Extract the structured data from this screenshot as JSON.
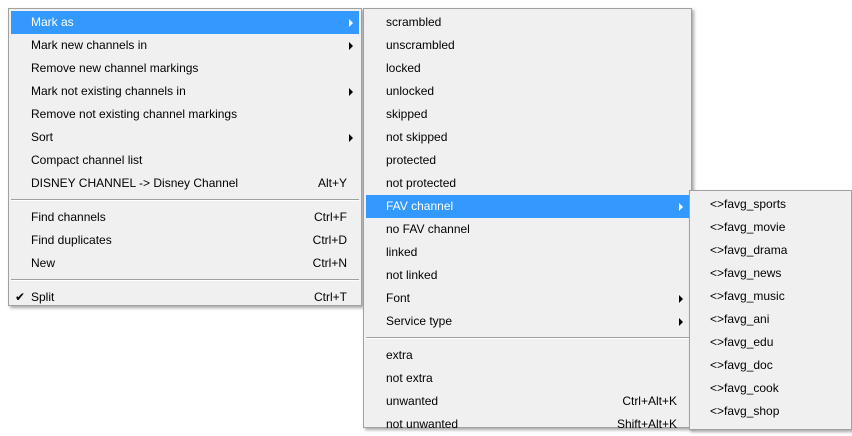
{
  "main_menu": {
    "items": [
      {
        "label": "Mark as",
        "shortcut": "",
        "submenu": true,
        "highlighted": true
      },
      {
        "label": "Mark new channels in",
        "shortcut": "",
        "submenu": true
      },
      {
        "label": "Remove new channel markings",
        "shortcut": ""
      },
      {
        "label": "Mark not existing channels in",
        "shortcut": "",
        "submenu": true
      },
      {
        "label": "Remove not existing channel markings",
        "shortcut": ""
      },
      {
        "label": "Sort",
        "shortcut": "",
        "submenu": true
      },
      {
        "label": "Compact channel list",
        "shortcut": ""
      },
      {
        "label": "DISNEY CHANNEL -> Disney Channel",
        "shortcut": "Alt+Y"
      },
      {
        "label": "Find channels",
        "shortcut": "Ctrl+F"
      },
      {
        "label": "Find duplicates",
        "shortcut": "Ctrl+D"
      },
      {
        "label": "New",
        "shortcut": "Ctrl+N"
      },
      {
        "label": "Split",
        "shortcut": "Ctrl+T",
        "checked": true
      }
    ]
  },
  "mark_as_menu": {
    "items": [
      {
        "label": "scrambled"
      },
      {
        "label": "unscrambled"
      },
      {
        "label": "locked"
      },
      {
        "label": "unlocked"
      },
      {
        "label": "skipped"
      },
      {
        "label": "not skipped"
      },
      {
        "label": "protected"
      },
      {
        "label": "not protected"
      },
      {
        "label": "FAV channel",
        "submenu": true,
        "highlighted": true
      },
      {
        "label": "no FAV channel"
      },
      {
        "label": "linked"
      },
      {
        "label": "not linked"
      },
      {
        "label": "Font",
        "submenu": true
      },
      {
        "label": "Service type",
        "submenu": true
      },
      {
        "label": "extra"
      },
      {
        "label": "not extra"
      },
      {
        "label": "unwanted",
        "shortcut": "Ctrl+Alt+K"
      },
      {
        "label": "not unwanted",
        "shortcut": "Shift+Alt+K"
      }
    ]
  },
  "fav_menu": {
    "items": [
      {
        "label": "<>favg_sports"
      },
      {
        "label": "<>favg_movie"
      },
      {
        "label": "<>favg_drama"
      },
      {
        "label": "<>favg_news"
      },
      {
        "label": "<>favg_music"
      },
      {
        "label": "<>favg_ani"
      },
      {
        "label": "<>favg_edu"
      },
      {
        "label": "<>favg_doc"
      },
      {
        "label": "<>favg_cook"
      },
      {
        "label": "<>favg_shop"
      }
    ]
  },
  "colors": {
    "highlight": "#3399ff",
    "menu_bg": "#f0f0f0"
  },
  "icons": {
    "check": "checkmark-icon",
    "submenu_arrow": "chevron-right-icon"
  }
}
